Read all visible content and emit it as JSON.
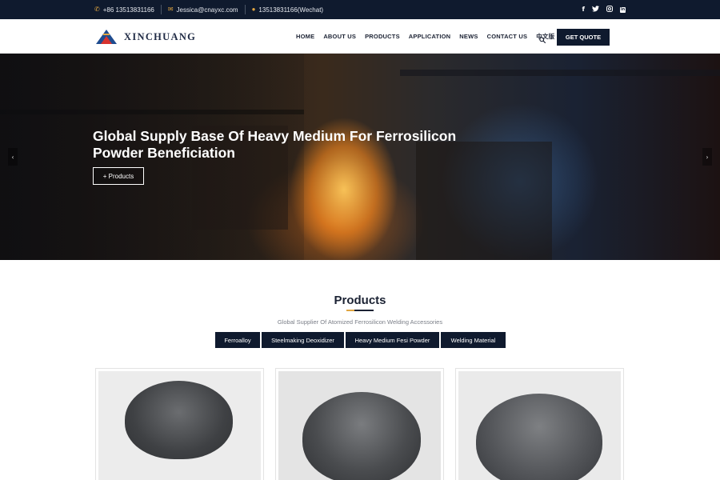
{
  "topbar": {
    "phone": "+86 13513831166",
    "email": "Jessica@cnayxc.com",
    "wechat": "13513831166(Wechat)",
    "social": [
      "facebook-icon",
      "twitter-icon",
      "instagram-icon",
      "linkedin-icon"
    ]
  },
  "header": {
    "brand": "XINCHUANG",
    "nav": [
      "HOME",
      "ABOUT US",
      "PRODUCTS",
      "APPLICATION",
      "NEWS",
      "CONTACT US",
      "中文版"
    ],
    "quote_button": "GET QUOTE"
  },
  "hero": {
    "title": "Global Supply Base Of Heavy Medium For Ferrosilicon Powder Beneficiation",
    "button": "+ Products",
    "prev_arrow": "‹",
    "next_arrow": "›"
  },
  "products": {
    "title": "Products",
    "subtitle": "Global Supplier Of Atomized Ferrosilicon Welding Accessories",
    "tabs": [
      "Ferroalloy",
      "Steelmaking Deoxidizer",
      "Heavy Medium Fesi Powder",
      "Welding Material"
    ]
  },
  "colors": {
    "navy": "#0f1a2e",
    "accent": "#e0a541",
    "logo_red": "#d7332f",
    "logo_blue": "#1f4c8f"
  }
}
